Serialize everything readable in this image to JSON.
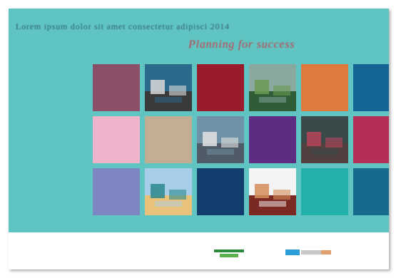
{
  "cover": {
    "title": "Lorem ipsum dolor sit amet consectetur adipisci 2014",
    "subtitle": "Planning for success"
  },
  "colors": {
    "background": "#5fc4c2",
    "title_text": "#2f5f78",
    "subtitle_text": "#c4404a"
  },
  "grid": {
    "rows": [
      [
        {
          "type": "color",
          "color": "#8a5068"
        },
        {
          "type": "photo",
          "name": "harbour-photo",
          "sky": "#2c6a8c",
          "ground": "#3a3a3a",
          "accent": "#d8d8d8"
        },
        {
          "type": "color",
          "color": "#981c2c"
        },
        {
          "type": "photo",
          "name": "garden-photo",
          "sky": "#88a8a0",
          "ground": "#2f5d38",
          "accent": "#6c9a52"
        },
        {
          "type": "color",
          "color": "#df7a3e"
        },
        {
          "type": "color",
          "color": "#156496"
        }
      ],
      [
        {
          "type": "color",
          "color": "#efb4cc"
        },
        {
          "type": "color",
          "color": "#c2ae90"
        },
        {
          "type": "photo",
          "name": "building-photo",
          "sky": "#6f92a6",
          "ground": "#4f5c68",
          "accent": "#e2e2e2"
        },
        {
          "type": "color",
          "color": "#5e2c82"
        },
        {
          "type": "photo",
          "name": "crowd-photo",
          "sky": "#3a4a4a",
          "ground": "#504040",
          "accent": "#b64458"
        },
        {
          "type": "color",
          "color": "#b52e58"
        }
      ],
      [
        {
          "type": "color",
          "color": "#7d86c2"
        },
        {
          "type": "photo",
          "name": "beach-photo",
          "sky": "#a8cde8",
          "ground": "#e8c27a",
          "accent": "#2c8a8c"
        },
        {
          "type": "color",
          "color": "#113e6c"
        },
        {
          "type": "photo",
          "name": "townhouse-photo",
          "sky": "#f4f4f4",
          "ground": "#7a2a22",
          "accent": "#d48c58"
        },
        {
          "type": "color",
          "color": "#23b0aa"
        },
        {
          "type": "color",
          "color": "#166a8e"
        }
      ]
    ]
  },
  "logos": {
    "left_colors": [
      "#2a8a3c",
      "#59b24a"
    ],
    "right_colors": [
      "#2a9ed8",
      "#c8c8c8",
      "#e0a070"
    ]
  }
}
